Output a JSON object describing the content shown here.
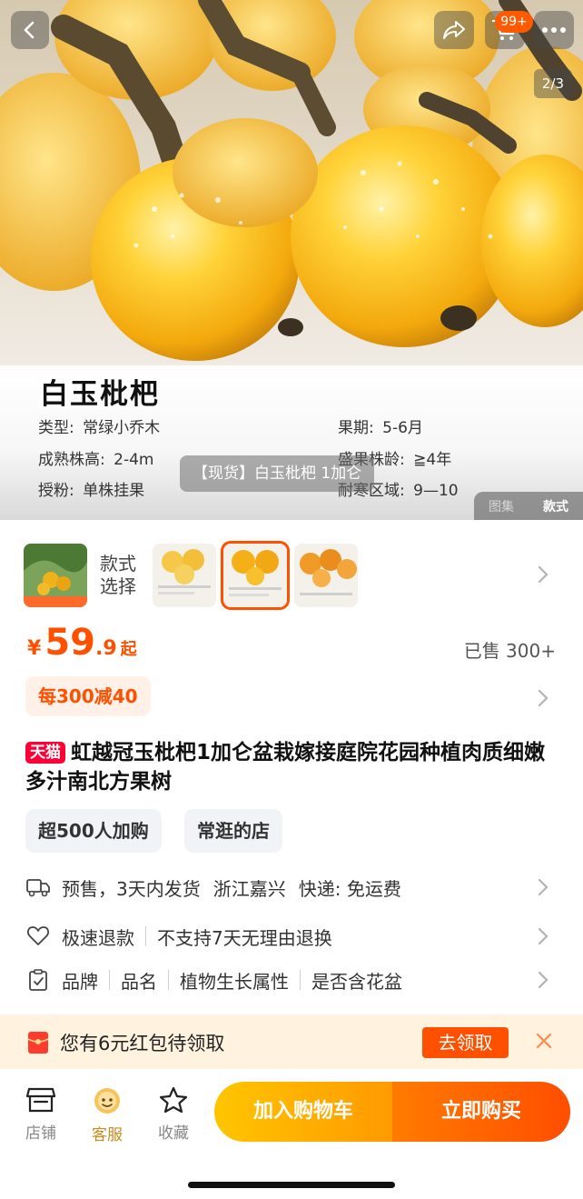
{
  "hero": {
    "page_indicator": "2/3",
    "cart_badge": "99+",
    "spec": {
      "title": "白玉枇杷",
      "rows": [
        {
          "k": "类型:",
          "v": "常绿小乔木"
        },
        {
          "k": "果期:",
          "v": "5-6月"
        },
        {
          "k": "成熟株高:",
          "v": "2-4m"
        },
        {
          "k": "盛果株龄:",
          "v": "≧4年"
        },
        {
          "k": "授粉:",
          "v": "单株挂果"
        },
        {
          "k": "耐寒区域:",
          "v": "9—10"
        }
      ]
    },
    "caption": "【现货】白玉枇杷 1加仑",
    "gallery_tabs": {
      "gallery": "图集",
      "style": "款式"
    }
  },
  "variants": {
    "label": [
      "款式",
      "选择"
    ]
  },
  "price": {
    "currency": "¥",
    "integer": "59",
    "decimal": ".9",
    "suffix": "起",
    "sold": "已售 300+"
  },
  "promo": "每300减40",
  "product": {
    "badge": "天猫",
    "title": "虹越冠玉枇杷1加仑盆栽嫁接庭院花园种植肉质细嫩多汁南北方果树"
  },
  "chips": [
    "超500人加购",
    "常逛的店"
  ],
  "info": {
    "shipping": {
      "presale": "预售，3天内发货",
      "origin": "浙江嘉兴",
      "express": "快递: 免运费"
    },
    "refund": {
      "fast": "极速退款",
      "policy": "不支持7天无理由退换"
    },
    "params": [
      "品牌",
      "品名",
      "植物生长属性",
      "是否含花盆"
    ]
  },
  "coupon": {
    "text": "您有6元红包待领取",
    "button": "去领取"
  },
  "bottom": {
    "shop": "店铺",
    "service": "客服",
    "favorite": "收藏",
    "add_to_cart": "加入购物车",
    "buy_now": "立即购买"
  },
  "colors": {
    "accent": "#ff5000",
    "tmall": "#ff0036",
    "cart_gradient": [
      "#ffc500",
      "#ff9a00"
    ],
    "buy_gradient": [
      "#ff7b00",
      "#ff4e00"
    ]
  }
}
